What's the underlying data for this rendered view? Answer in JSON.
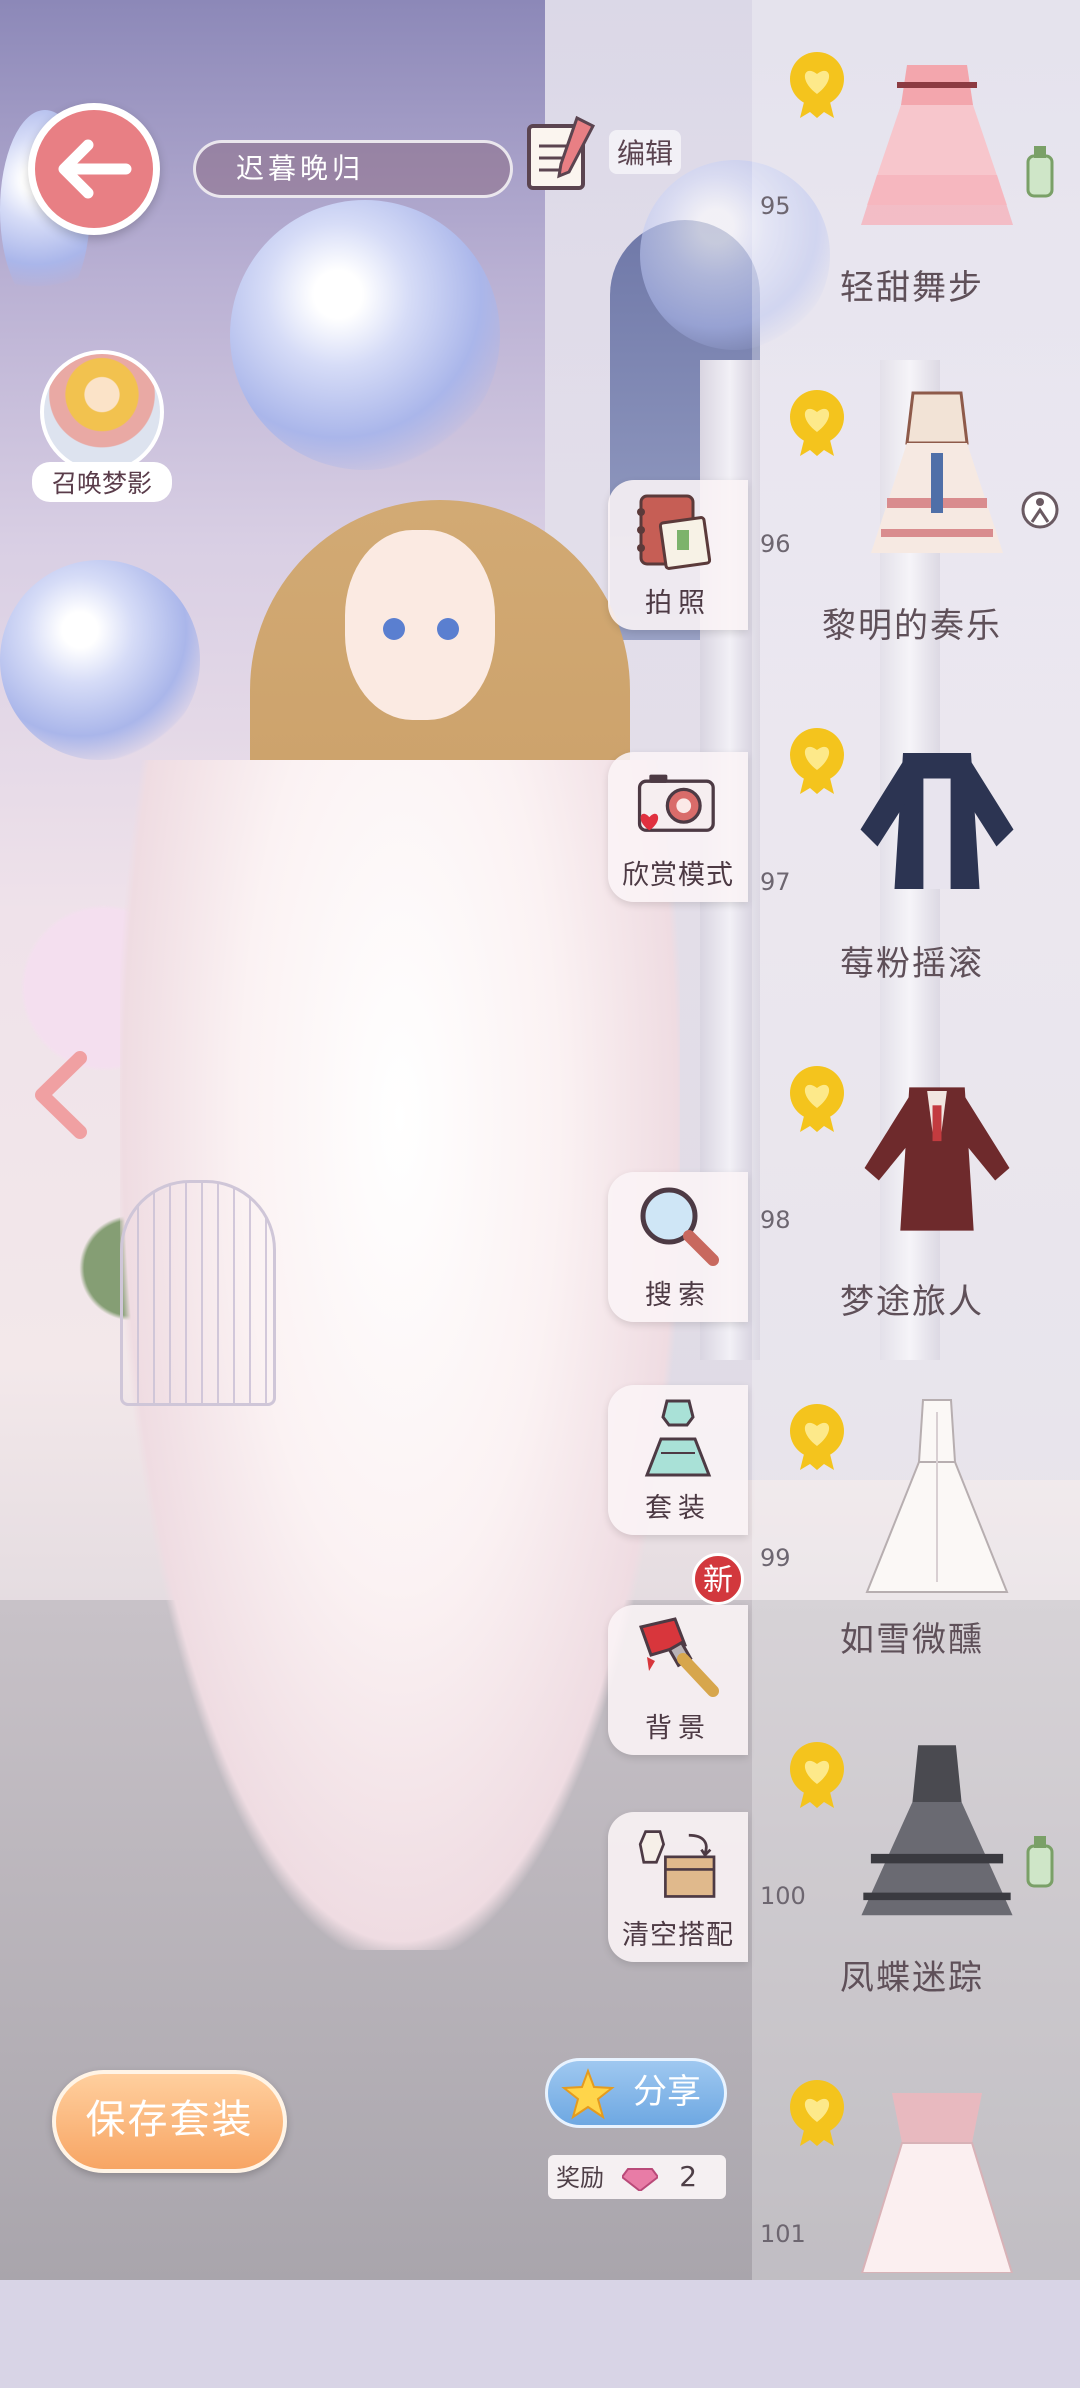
{
  "header": {
    "outfit_name": "迟暮晚归",
    "edit_label": "编辑"
  },
  "summon": {
    "label": "召唤梦影"
  },
  "side_menu": {
    "photo": "拍照",
    "appreciate": "欣赏模式",
    "search": "搜索",
    "suits": "套装",
    "background": "背景",
    "new_badge": "新",
    "clear": "清空搭配"
  },
  "items": [
    {
      "number": "95",
      "name": "轻甜舞步",
      "icon": "pink-ruffle-dress-icon"
    },
    {
      "number": "96",
      "name": "黎明的奏乐",
      "icon": "cream-layered-dress-icon"
    },
    {
      "number": "97",
      "name": "莓粉摇滚",
      "icon": "navy-jacket-icon"
    },
    {
      "number": "98",
      "name": "梦途旅人",
      "icon": "burgundy-coat-icon"
    },
    {
      "number": "99",
      "name": "如雪微醺",
      "icon": "white-gown-icon"
    },
    {
      "number": "100",
      "name": "凤蝶迷踪",
      "icon": "black-butterfly-dress-icon"
    },
    {
      "number": "101",
      "name": "",
      "icon": "blush-lace-gown-icon"
    }
  ],
  "bottom": {
    "save_label": "保存套装",
    "share_label": "分享",
    "reward_label": "奖励",
    "reward_count": "2"
  },
  "colors": {
    "accent_pink": "#e87f84",
    "save_orange": "#f7a564",
    "share_blue": "#6ea8e2",
    "badge_red": "#d2383d",
    "medal_gold": "#f4c41d"
  }
}
